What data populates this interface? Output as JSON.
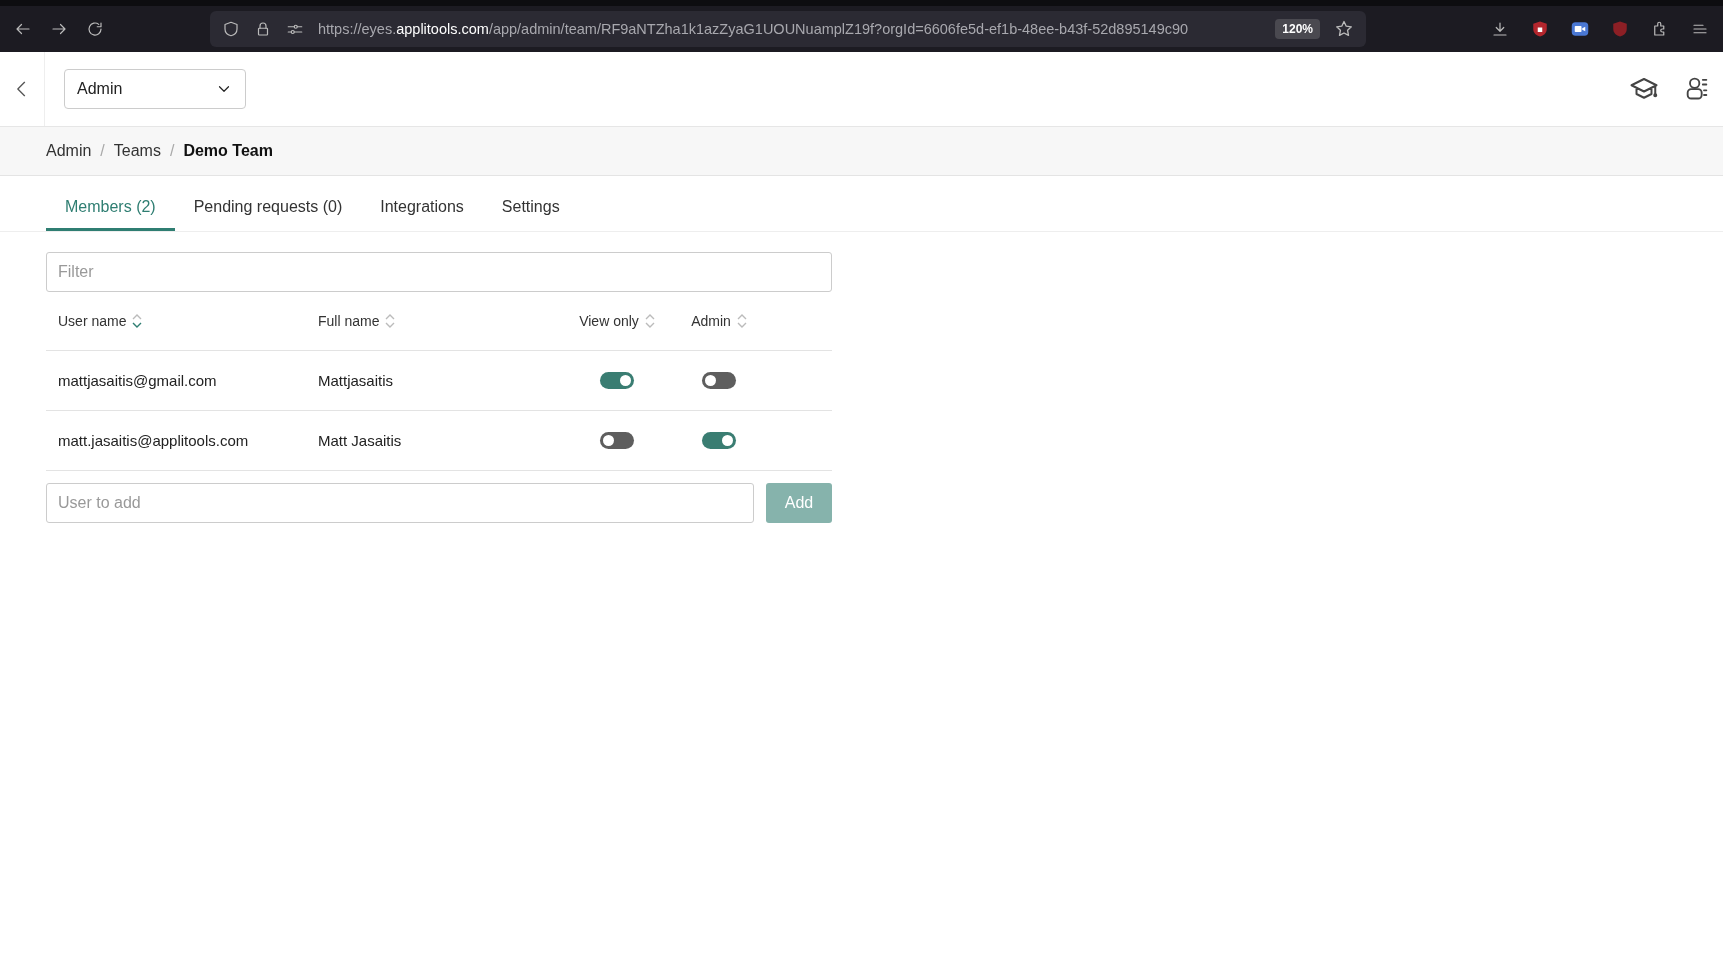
{
  "browser": {
    "url": "https://eyes.**applitools.com**/app/admin/team/RF9aNTZha1k1azZyaG1UOUNuamplZ19f?orgId=6606fe5d-ef1b-48ee-b43f-52d895149c90",
    "zoom": "120%"
  },
  "header": {
    "org_select": "Admin"
  },
  "breadcrumb": [
    {
      "kind": "link",
      "text": "Admin"
    },
    {
      "kind": "separator",
      "text": "/"
    },
    {
      "kind": "link",
      "text": "Teams"
    },
    {
      "kind": "separator",
      "text": "/"
    },
    {
      "kind": "current",
      "text": "Demo Team"
    }
  ],
  "tabs": [
    {
      "label": "Members (2)",
      "selected": true
    },
    {
      "label": "Pending requests (0)",
      "selected": false
    },
    {
      "label": "Integrations",
      "selected": false
    },
    {
      "label": "Settings",
      "selected": false
    }
  ],
  "filter": {
    "placeholder": "Filter"
  },
  "table": {
    "columns": [
      {
        "label": "User name",
        "sorted": true
      },
      {
        "label": "Full name",
        "sorted": false
      },
      {
        "label": "View only",
        "sorted": false
      },
      {
        "label": "Admin",
        "sorted": false
      }
    ],
    "rows": [
      {
        "user_name": "mattjasaitis@gmail.com",
        "full_name": "Mattjasaitis",
        "view_only": true,
        "admin": false
      },
      {
        "user_name": "matt.jasaitis@applitools.com",
        "full_name": "Matt Jasaitis",
        "view_only": false,
        "admin": true
      }
    ]
  },
  "add_user": {
    "placeholder": "User to add",
    "button": "Add",
    "disabled": true
  }
}
